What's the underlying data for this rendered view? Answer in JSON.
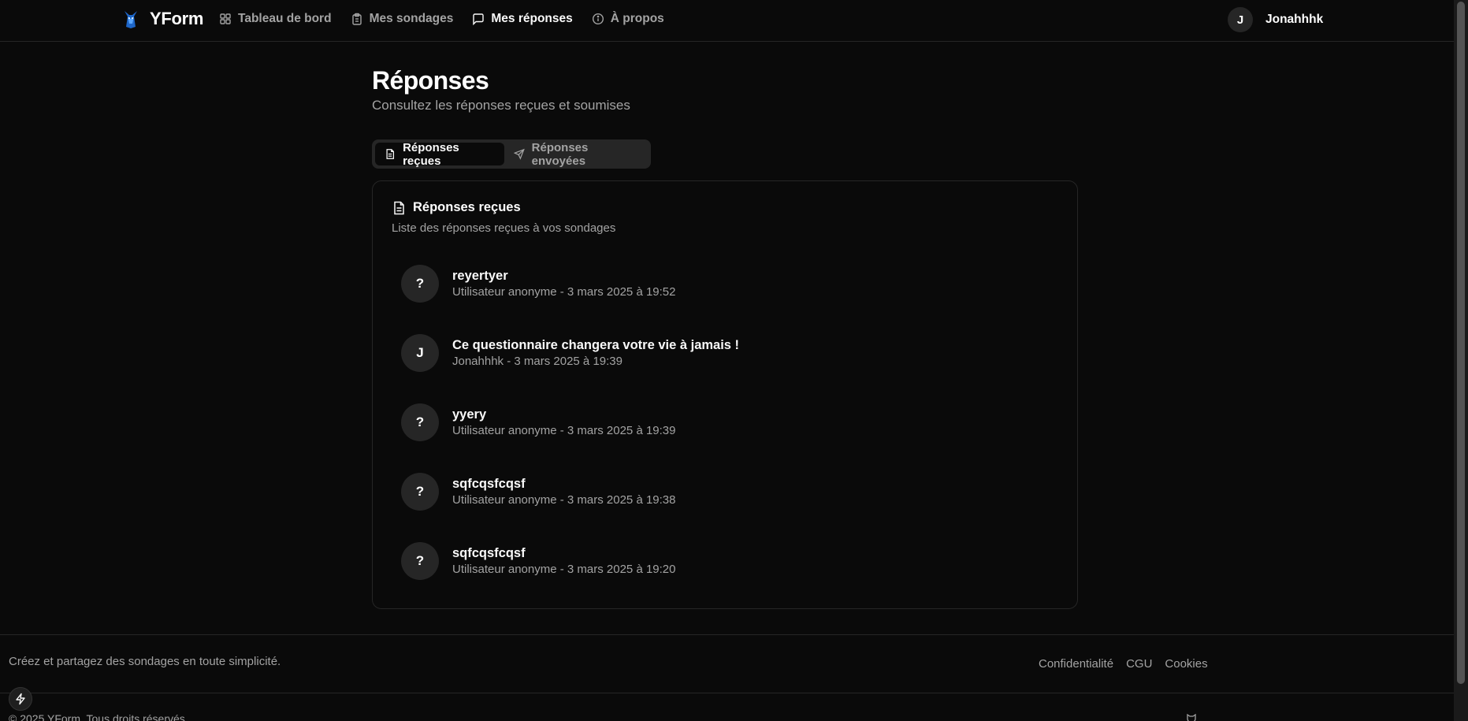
{
  "brand": {
    "name": "YForm",
    "logo_icon": "fox-logo-icon"
  },
  "nav": {
    "items": [
      {
        "label": "Tableau de bord",
        "icon": "dashboard-icon",
        "active": false
      },
      {
        "label": "Mes sondages",
        "icon": "clipboard-icon",
        "active": false
      },
      {
        "label": "Mes réponses",
        "icon": "message-square-icon",
        "active": true
      },
      {
        "label": "À propos",
        "icon": "info-icon",
        "active": false
      }
    ]
  },
  "user": {
    "initial": "J",
    "name": "Jonahhhk"
  },
  "page": {
    "title": "Réponses",
    "subtitle": "Consultez les réponses reçues et soumises"
  },
  "tabs": [
    {
      "label": "Réponses reçues",
      "icon": "file-text-icon",
      "active": true
    },
    {
      "label": "Réponses envoyées",
      "icon": "send-icon",
      "active": false
    }
  ],
  "card": {
    "title": "Réponses reçues",
    "description": "Liste des réponses reçues à vos sondages"
  },
  "responses": [
    {
      "initial": "?",
      "title": "reyertyer",
      "meta": "Utilisateur anonyme - 3 mars 2025 à 19:52"
    },
    {
      "initial": "J",
      "title": "Ce questionnaire changera votre vie à jamais !",
      "meta": "Jonahhhk - 3 mars 2025 à 19:39"
    },
    {
      "initial": "?",
      "title": "yyery",
      "meta": "Utilisateur anonyme - 3 mars 2025 à 19:39"
    },
    {
      "initial": "?",
      "title": "sqfcqsfcqsf",
      "meta": "Utilisateur anonyme - 3 mars 2025 à 19:38"
    },
    {
      "initial": "?",
      "title": "sqfcqsfcqsf",
      "meta": "Utilisateur anonyme - 3 mars 2025 à 19:20"
    }
  ],
  "footer": {
    "tagline": "Créez et partagez des sondages en toute simplicité.",
    "links": [
      "Confidentialité",
      "CGU",
      "Cookies"
    ],
    "copyright": "© 2025 YForm. Tous droits réservés."
  },
  "colors": {
    "background": "#0a0a0a",
    "muted": "#262626",
    "muted_text": "#a3a3a3",
    "text": "#fafafa"
  }
}
